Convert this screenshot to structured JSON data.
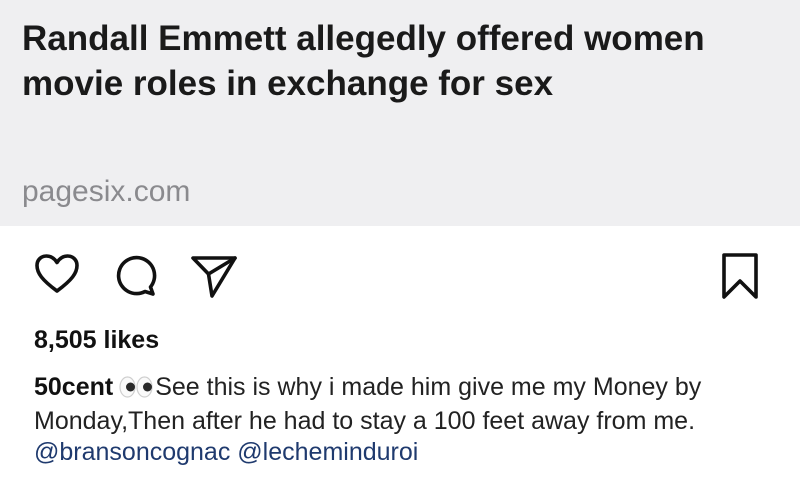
{
  "link_preview": {
    "title": "Randall Emmett allegedly offered women movie roles in exchange for sex",
    "domain": "pagesix.com"
  },
  "actions": {
    "like_icon": "heart-icon",
    "comment_icon": "comment-icon",
    "share_icon": "send-icon",
    "save_icon": "bookmark-icon"
  },
  "likes": "8,505 likes",
  "caption": {
    "username": "50cent",
    "emoji": "eyes-emoji",
    "text": "See this is why i made him give me my Money by Monday,Then after he had to stay a 100 feet away from me.",
    "mentions": [
      "@bransoncognac",
      "@lecheminduroi"
    ]
  },
  "colors": {
    "card_background": "#efeff1",
    "domain_text": "#8a8a8e",
    "mention_text": "#1f3a6e"
  }
}
